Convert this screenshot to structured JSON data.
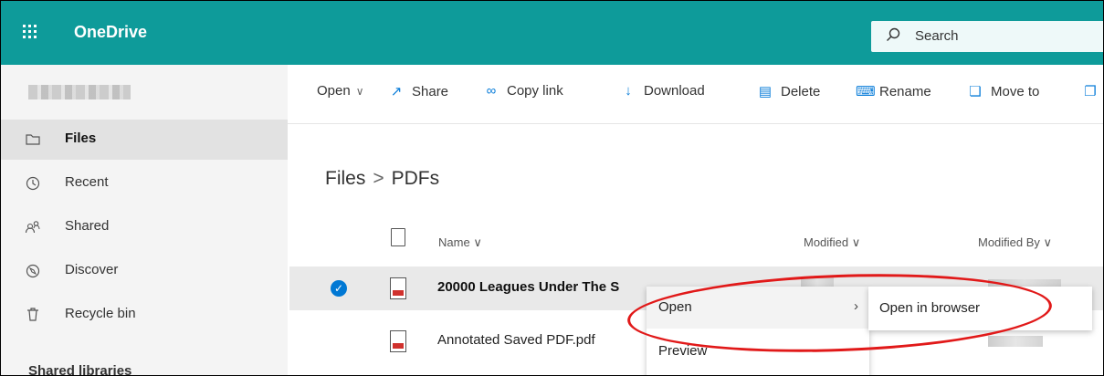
{
  "app": {
    "title": "OneDrive"
  },
  "search": {
    "label": "Search"
  },
  "sidebar": {
    "items": [
      {
        "label": "Files",
        "icon": "folder-icon",
        "active": true
      },
      {
        "label": "Recent",
        "icon": "clock-icon"
      },
      {
        "label": "Shared",
        "icon": "people-icon"
      },
      {
        "label": "Discover",
        "icon": "compass-icon"
      },
      {
        "label": "Recycle bin",
        "icon": "trash-icon"
      }
    ],
    "section_label": "Shared libraries"
  },
  "toolbar": {
    "open": "Open",
    "share": "Share",
    "copy_link": "Copy link",
    "download": "Download",
    "delete": "Delete",
    "rename": "Rename",
    "move_to": "Move to"
  },
  "breadcrumb": {
    "root": "Files",
    "separator": ">",
    "current": "PDFs"
  },
  "columns": {
    "name": "Name",
    "modified": "Modified",
    "modified_by": "Modified By"
  },
  "files": [
    {
      "name": "20000 Leagues Under The S",
      "selected": true
    },
    {
      "name": "Annotated Saved PDF.pdf",
      "selected": false
    }
  ],
  "context_menu": {
    "items": [
      {
        "label": "Open",
        "has_submenu": true
      },
      {
        "label": "Preview"
      }
    ],
    "submenu": {
      "label": "Open in browser"
    }
  },
  "colors": {
    "brand": "#0e9b9a",
    "accent": "#0078d4",
    "highlight": "#e11919"
  }
}
